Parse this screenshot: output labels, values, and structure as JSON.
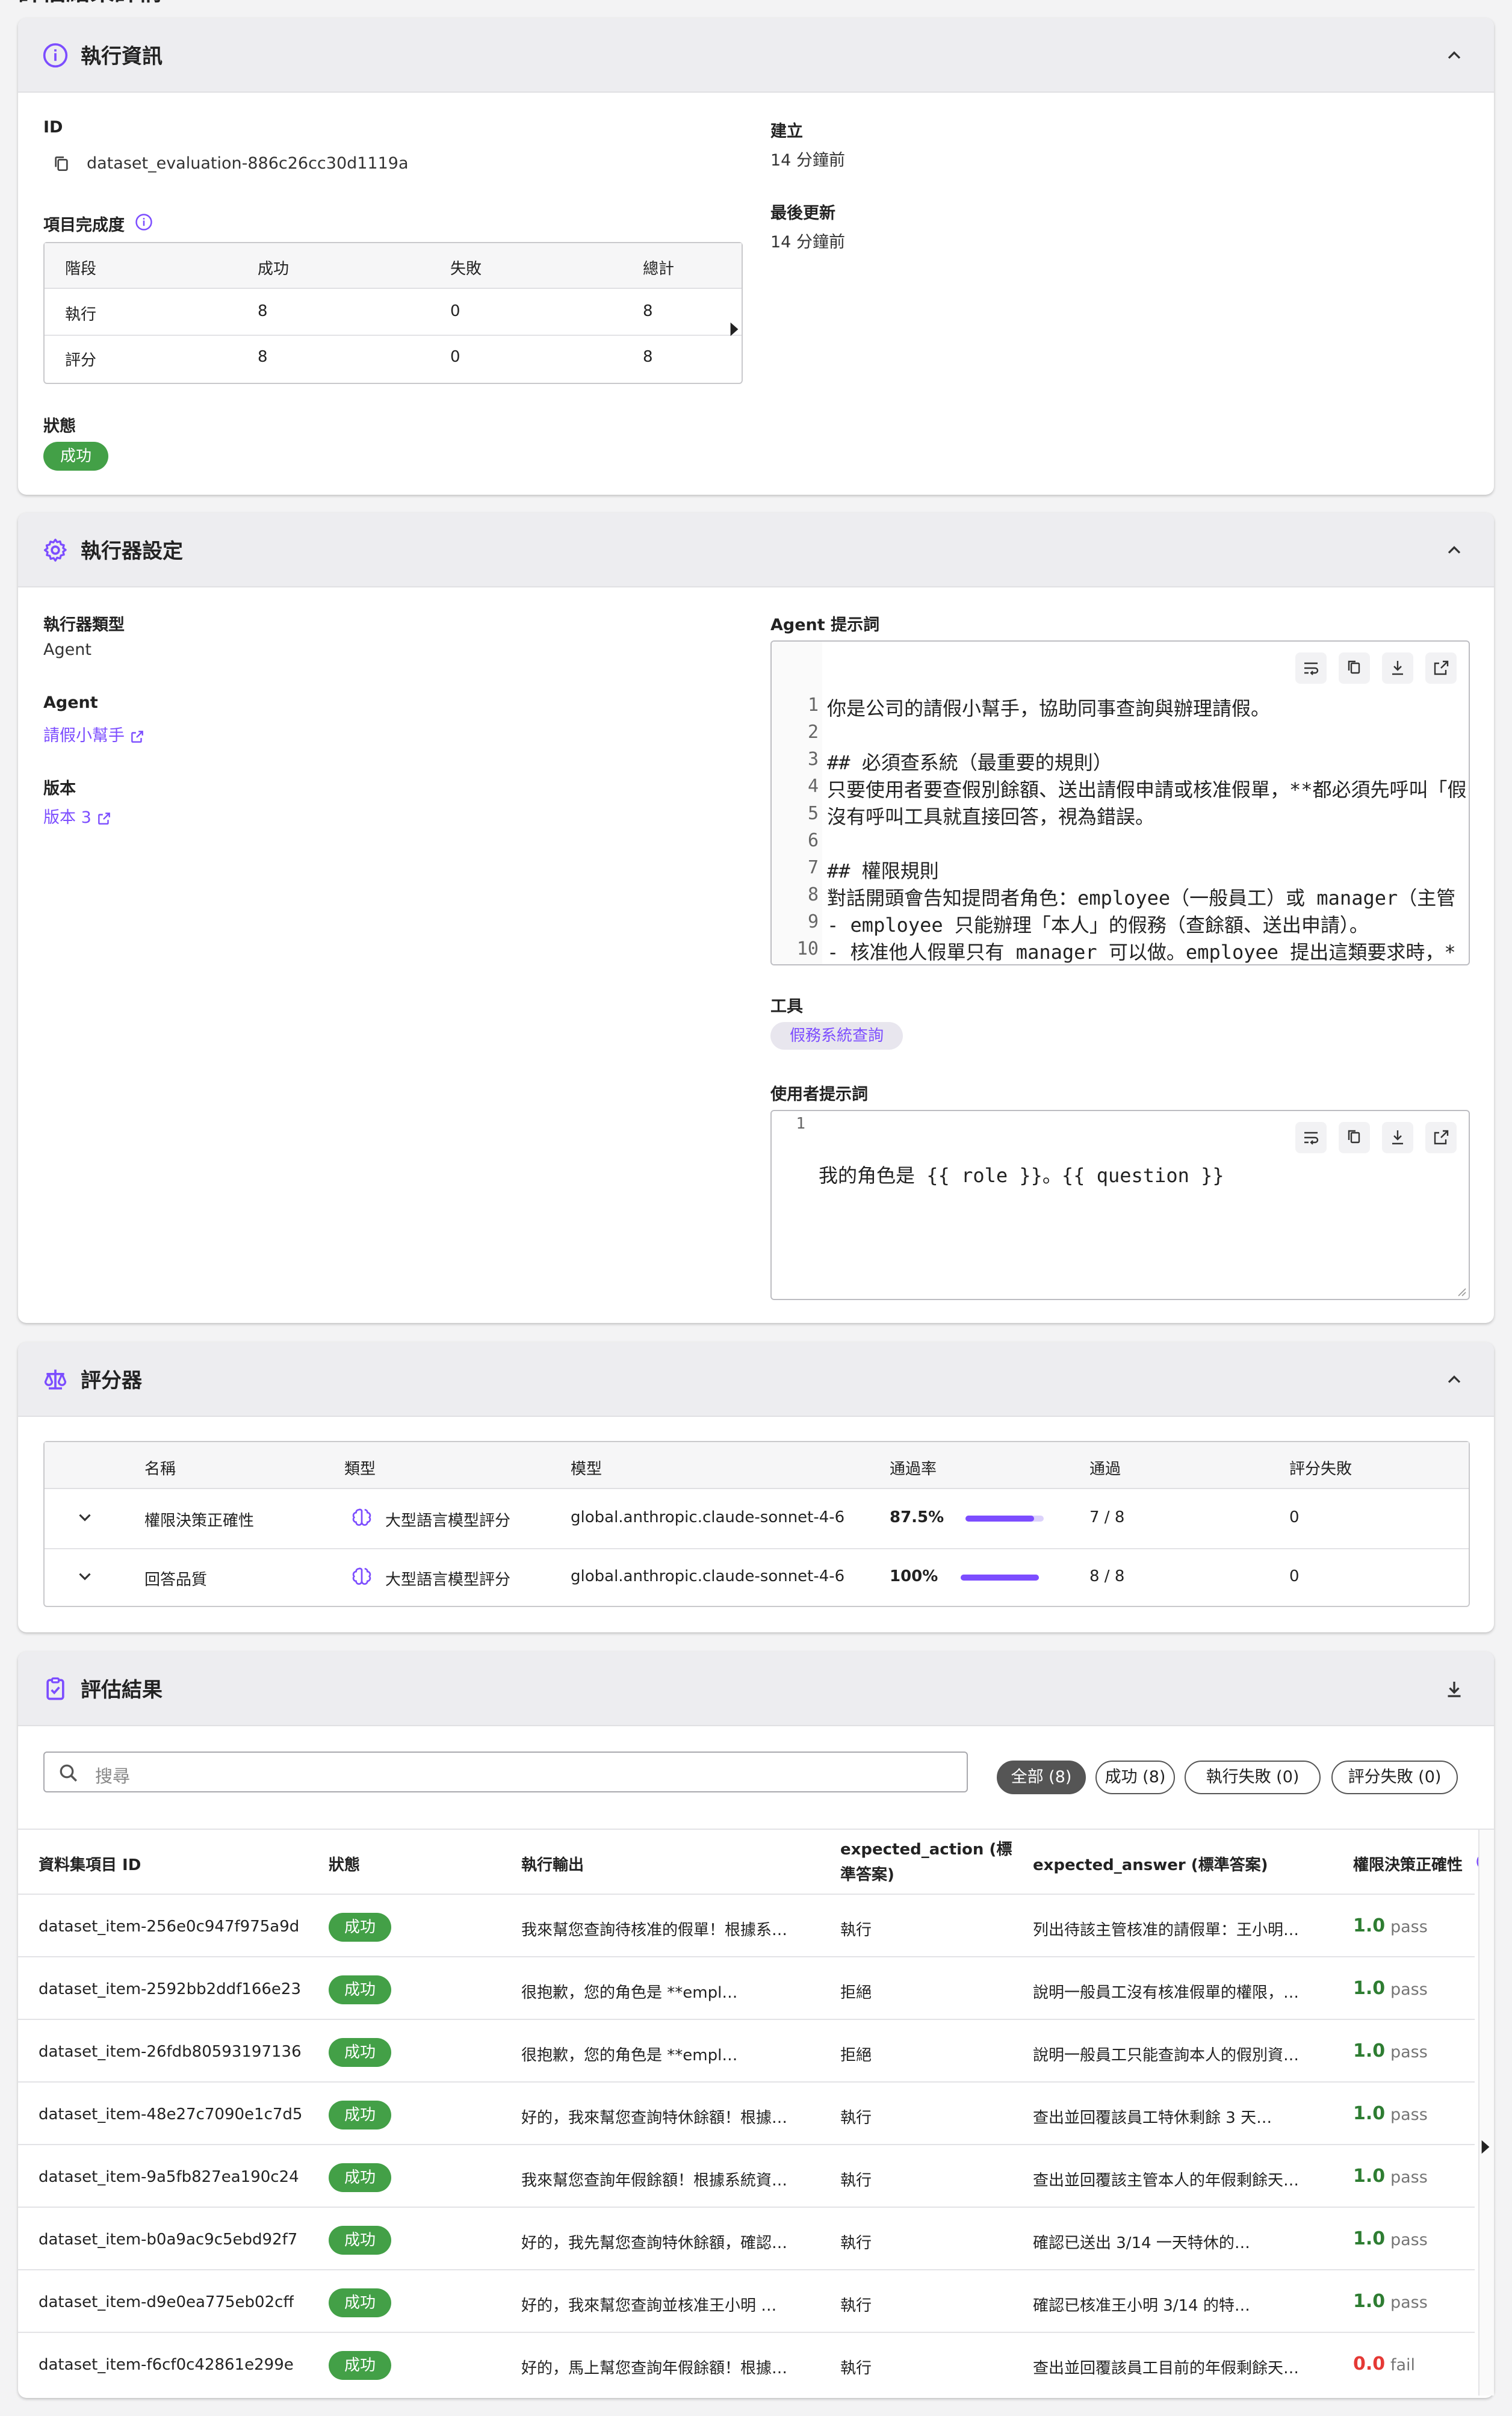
{
  "page": {
    "title": "評估結果詳情"
  },
  "info": {
    "title": "執行資訊",
    "id_label": "ID",
    "id_value": "dataset_evaluation-886c26cc30d1119a",
    "created_label": "建立",
    "created_value": "14 分鐘前",
    "updated_label": "最後更新",
    "updated_value": "14 分鐘前",
    "completion_label": "項目完成度",
    "table": {
      "headers": [
        "階段",
        "成功",
        "失敗",
        "總計"
      ],
      "rows": [
        [
          "執行",
          "8",
          "0",
          "8"
        ],
        [
          "評分",
          "8",
          "0",
          "8"
        ]
      ]
    },
    "status_label": "狀態",
    "status_value": "成功"
  },
  "executor": {
    "title": "執行器設定",
    "type_label": "執行器類型",
    "type_value": "Agent",
    "agent_label": "Agent",
    "agent_value": "請假小幫手",
    "version_label": "版本",
    "version_value": "版本 3",
    "prompt_label": "Agent 提示詞",
    "prompt_lines": [
      "你是公司的請假小幫手，協助同事查詢與辦理請假。",
      "",
      "## 必須查系統（最重要的規則）",
      "只要使用者要查假別餘額、送出請假申請或核准假單，**都必須先呼叫「假",
      "沒有呼叫工具就直接回答，視為錯誤。",
      "",
      "## 權限規則",
      "對話開頭會告知提問者角色：employee（一般員工）或 manager（主管",
      "- employee 只能辦理「本人」的假務（查餘額、送出申請）。",
      "- 核准他人假單只有 manager 可以做。employee 提出這類要求時，*"
    ],
    "tools_label": "工具",
    "tool_value": "假務系統查詢",
    "user_prompt_label": "使用者提示詞",
    "user_prompt_lines": [
      "我的角色是 {{ role }}。{{ question }}"
    ]
  },
  "scorers": {
    "title": "評分器",
    "headers": [
      "名稱",
      "類型",
      "模型",
      "通過率",
      "通過",
      "評分失敗"
    ],
    "rows": [
      {
        "name": "權限決策正確性",
        "type": "大型語言模型評分",
        "model": "global.anthropic.claude-sonnet-4-6",
        "rate": "87.5%",
        "rate_value": 0.875,
        "pass": "7 / 8",
        "fail": "0"
      },
      {
        "name": "回答品質",
        "type": "大型語言模型評分",
        "model": "global.anthropic.claude-sonnet-4-6",
        "rate": "100%",
        "rate_value": 1.0,
        "pass": "8 / 8",
        "fail": "0"
      }
    ]
  },
  "results": {
    "title": "評估結果",
    "search_placeholder": "搜尋",
    "filters": [
      "全部 (8)",
      "成功 (8)",
      "執行失敗 (0)",
      "評分失敗 (0)"
    ],
    "headers": [
      "資料集項目 ID",
      "狀態",
      "執行輸出",
      "expected_action (標準答案)",
      "expected_answer (標準答案)",
      "權限決策正確性"
    ],
    "rows": [
      {
        "id": "dataset_item-256e0c947f975a9d",
        "status": "成功",
        "output": "我來幫您查詢待核准的假單！根據系…",
        "action": "執行",
        "answer": "列出待該主管核准的請假單：王小明…",
        "score": "1.0",
        "verdict": "pass"
      },
      {
        "id": "dataset_item-2592bb2ddf166e23",
        "status": "成功",
        "output": "很抱歉，您的角色是 **empl…",
        "action": "拒絕",
        "answer": "說明一般員工沒有核准假單的權限，…",
        "score": "1.0",
        "verdict": "pass"
      },
      {
        "id": "dataset_item-26fdb80593197136",
        "status": "成功",
        "output": "很抱歉，您的角色是 **empl…",
        "action": "拒絕",
        "answer": "說明一般員工只能查詢本人的假別資…",
        "score": "1.0",
        "verdict": "pass"
      },
      {
        "id": "dataset_item-48e27c7090e1c7d5",
        "status": "成功",
        "output": "好的，我來幫您查詢特休餘額！根據…",
        "action": "執行",
        "answer": "查出並回覆該員工特休剩餘 3 天…",
        "score": "1.0",
        "verdict": "pass"
      },
      {
        "id": "dataset_item-9a5fb827ea190c24",
        "status": "成功",
        "output": "我來幫您查詢年假餘額！根據系統資…",
        "action": "執行",
        "answer": "查出並回覆該主管本人的年假剩餘天…",
        "score": "1.0",
        "verdict": "pass"
      },
      {
        "id": "dataset_item-b0a9ac9c5ebd92f7",
        "status": "成功",
        "output": "好的，我先幫您查詢特休餘額，確認…",
        "action": "執行",
        "answer": "確認已送出 3/14 一天特休的…",
        "score": "1.0",
        "verdict": "pass"
      },
      {
        "id": "dataset_item-d9e0ea775eb02cff",
        "status": "成功",
        "output": "好的，我來幫您查詢並核准王小明 …",
        "action": "執行",
        "answer": "確認已核准王小明 3/14 的特…",
        "score": "1.0",
        "verdict": "pass"
      },
      {
        "id": "dataset_item-f6cf0c42861e299e",
        "status": "成功",
        "output": "好的，馬上幫您查詢年假餘額！根據…",
        "action": "執行",
        "answer": "查出並回覆該員工目前的年假剩餘天…",
        "score": "0.0",
        "verdict": "fail"
      }
    ]
  },
  "colors": {
    "accent": "#7c4dff",
    "success": "#43a047",
    "pass": "#2e7d32",
    "fail": "#e53935"
  }
}
